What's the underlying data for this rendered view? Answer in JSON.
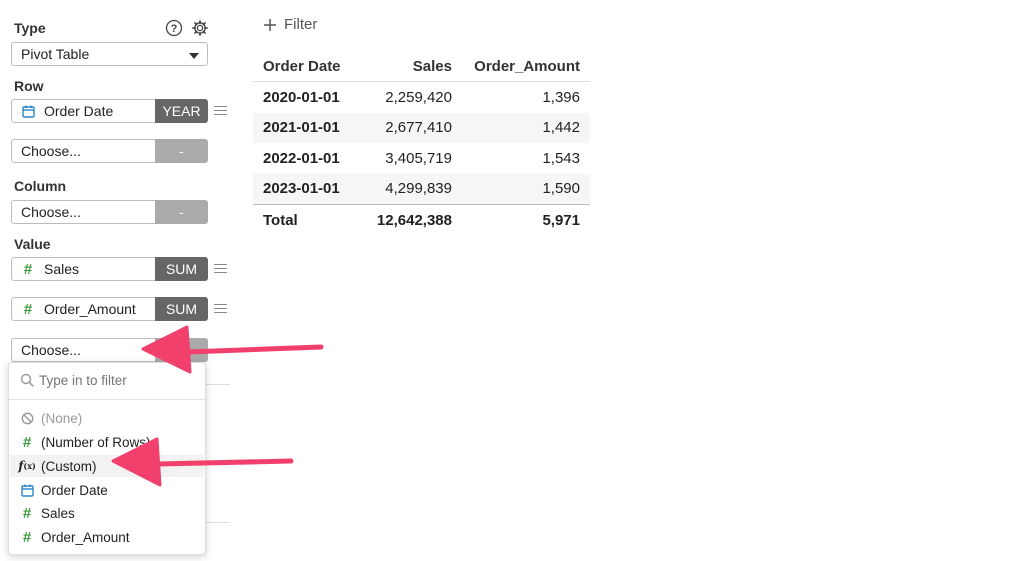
{
  "sidebar": {
    "type_label": "Type",
    "type_value": "Pivot Table",
    "row_label": "Row",
    "row_fields": [
      {
        "label": "Order Date",
        "agg": "YEAR",
        "icon": "calendar-icon"
      },
      {
        "label": "Choose...",
        "agg": "-"
      }
    ],
    "column_label": "Column",
    "column_fields": [
      {
        "label": "Choose...",
        "agg": "-"
      }
    ],
    "value_label": "Value",
    "value_fields": [
      {
        "label": "Sales",
        "agg": "SUM",
        "icon": "hash-icon"
      },
      {
        "label": "Order_Amount",
        "agg": "SUM",
        "icon": "hash-icon"
      },
      {
        "label": "Choose..."
      }
    ]
  },
  "dropdown": {
    "placeholder": "Type in to filter",
    "items": [
      {
        "label": "(None)",
        "icon": "none-icon"
      },
      {
        "label": "(Number of Rows)",
        "icon": "hash-icon"
      },
      {
        "label": "(Custom)",
        "icon": "function-icon"
      },
      {
        "label": "Order Date",
        "icon": "calendar-icon"
      },
      {
        "label": "Sales",
        "icon": "hash-icon"
      },
      {
        "label": "Order_Amount",
        "icon": "hash-icon"
      }
    ]
  },
  "filter": {
    "label": "Filter"
  },
  "table": {
    "headers": [
      "Order Date",
      "Sales",
      "Order_Amount"
    ],
    "rows": [
      [
        "2020-01-01",
        "2,259,420",
        "1,396"
      ],
      [
        "2021-01-01",
        "2,677,410",
        "1,442"
      ],
      [
        "2022-01-01",
        "3,405,719",
        "1,543"
      ],
      [
        "2023-01-01",
        "4,299,839",
        "1,590"
      ]
    ],
    "total": [
      "Total",
      "12,642,388",
      "5,971"
    ]
  },
  "colors": {
    "arrow": "#f2406d",
    "hash": "#3c9a3c",
    "calendar": "#2a86c9",
    "agg_dark": "#666666"
  }
}
